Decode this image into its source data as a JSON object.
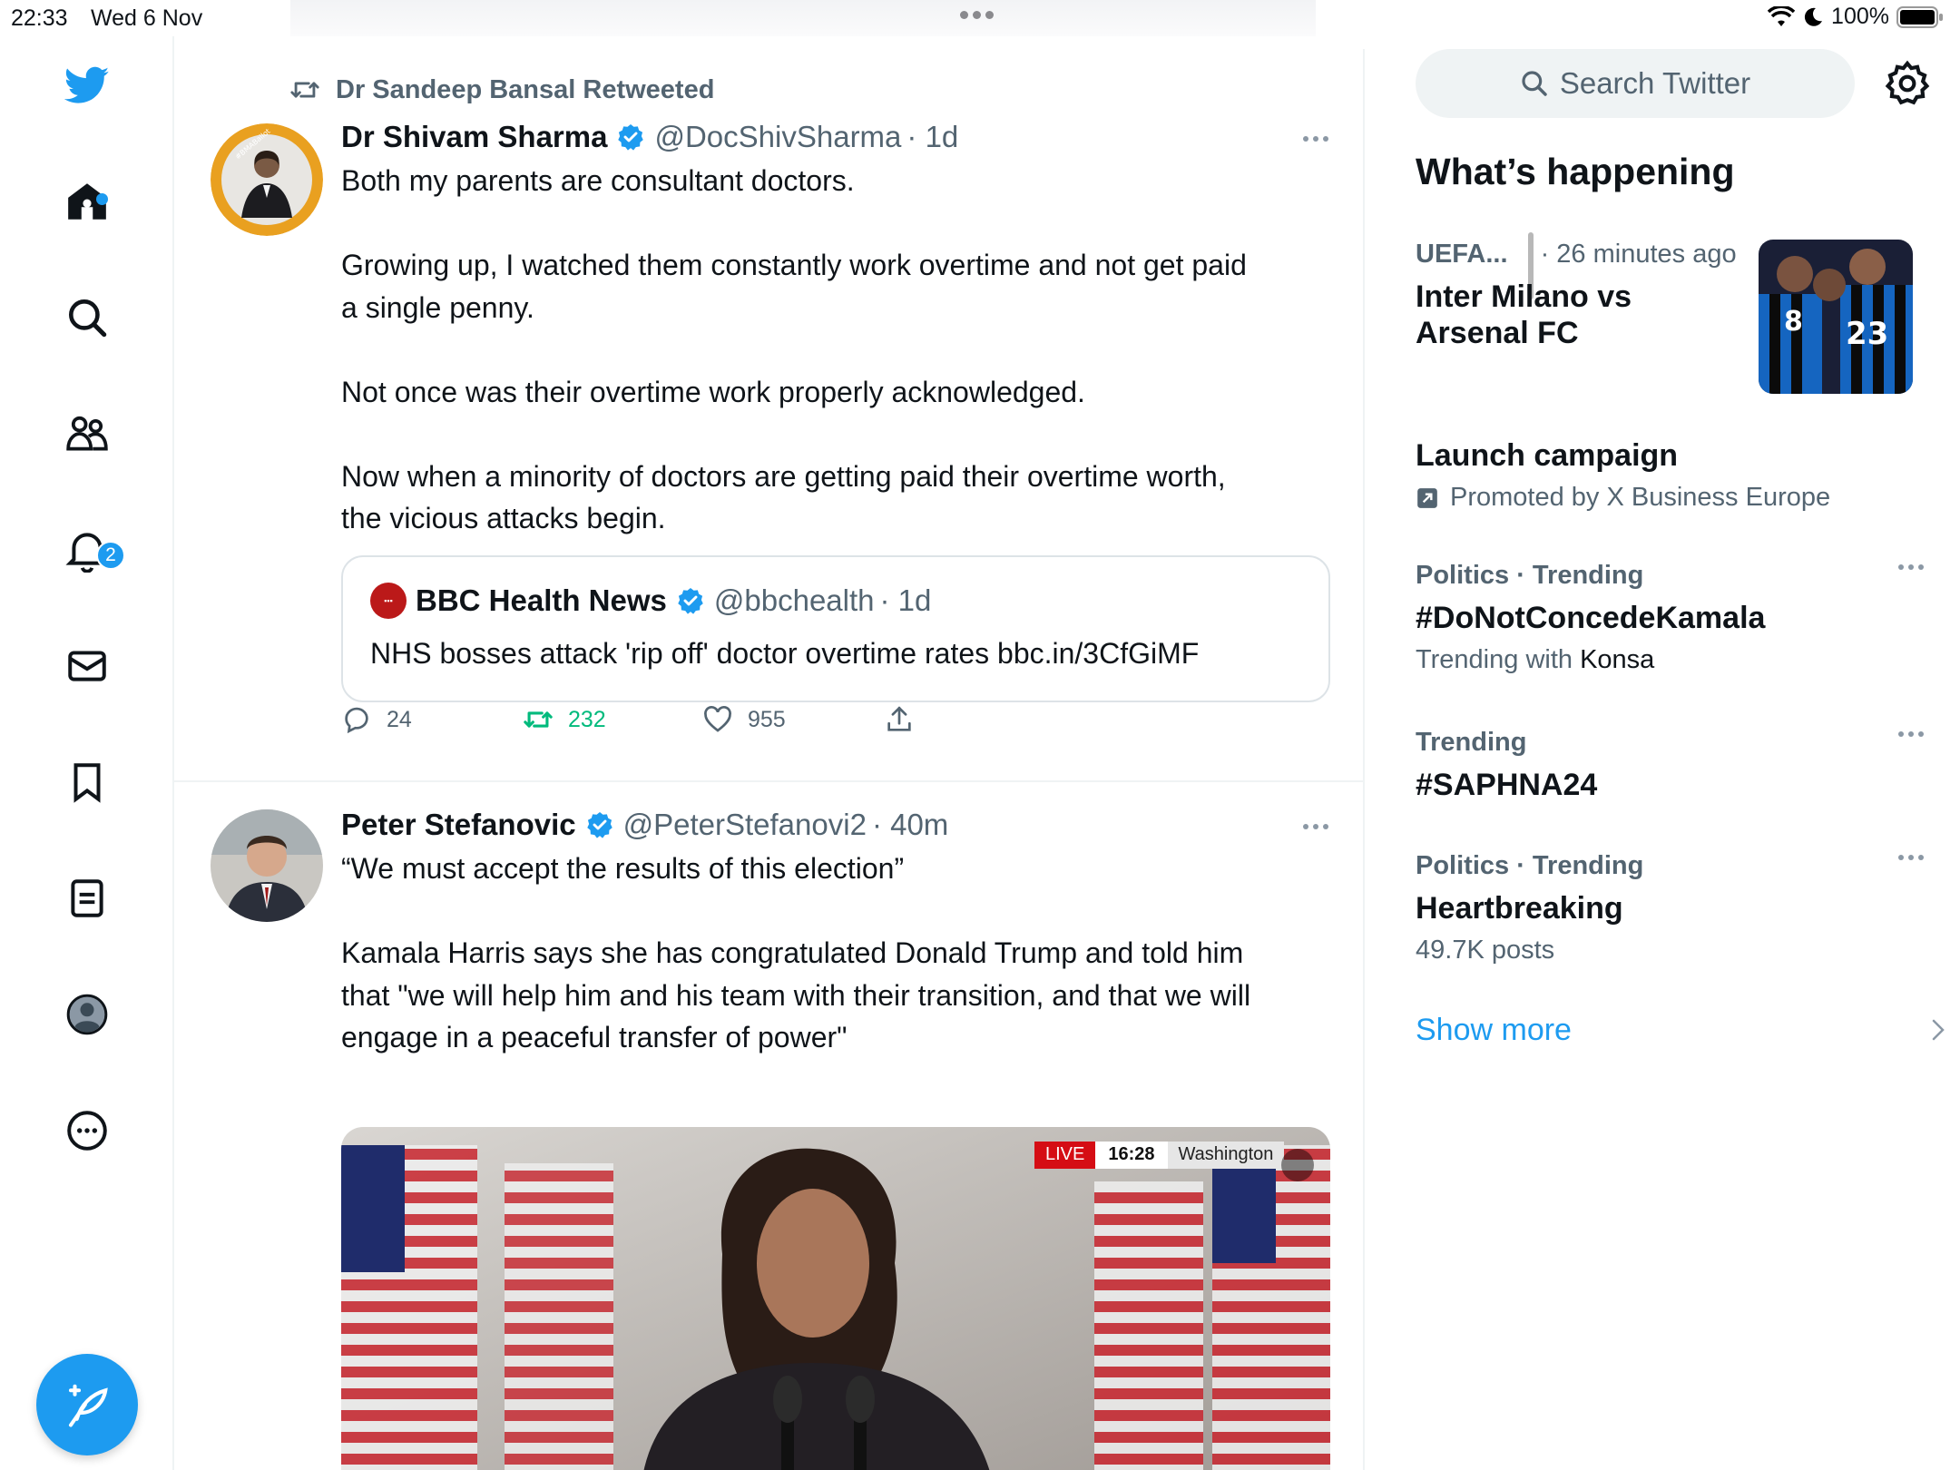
{
  "status_bar": {
    "time": "22:33",
    "date": "Wed 6 Nov",
    "battery": "100%"
  },
  "nav": {
    "notification_count": "2"
  },
  "tweets": [
    {
      "retweeted_by": "Dr Sandeep Bansal Retweeted",
      "name": "Dr Shivam Sharma",
      "handle": "@DocShivSharma",
      "time": "· 1d",
      "lines": [
        "Both my parents are consultant doctors.",
        "",
        "Growing up, I watched them constantly work overtime and not get paid",
        "a single penny.",
        "",
        "Not once was their overtime work properly acknowledged.",
        "",
        "Now when a minority of doctors are getting paid their overtime worth,",
        "the vicious attacks begin."
      ],
      "quote": {
        "name": "BBC Health News",
        "handle": "@bbchealth",
        "time": "· 1d",
        "text": "NHS bosses attack 'rip off' doctor overtime rates bbc.in/3CfGiMF"
      },
      "replies": "24",
      "retweets": "232",
      "likes": "955"
    },
    {
      "name": "Peter Stefanovic",
      "handle": "@PeterStefanovi2",
      "time": "· 40m",
      "lines": [
        "“We must accept the results of this election”",
        "",
        "Kamala Harris says she has congratulated Donald Trump and told him",
        "that \"we will help him and his team with their transition, and that we will",
        "engage in a peaceful transfer of power\""
      ],
      "media_overlay": {
        "live": "LIVE",
        "clock": "16:28",
        "place": "Washington"
      }
    }
  ],
  "sidebar": {
    "search_placeholder": "Search Twitter",
    "title": "What’s happening",
    "trends": [
      {
        "meta": "UEFA...",
        "meta_time": "· 26 minutes ago",
        "title": "Inter Milano vs Arsenal FC"
      },
      {
        "title": "Launch campaign",
        "sub": "Promoted by X Business Europe"
      },
      {
        "meta": "Politics · Trending",
        "title": "#DoNotConcedeKamala",
        "sub_prefix": "Trending with ",
        "sub_strong": "Konsa"
      },
      {
        "meta": "Trending",
        "title": "#SAPHNA24"
      },
      {
        "meta": "Politics · Trending",
        "title": "Heartbreaking",
        "sub": "49.7K posts"
      }
    ],
    "show_more": "Show more"
  },
  "colors": {
    "accent": "#1d9bf0",
    "retweet_green": "#00ba7c",
    "muted": "#536471"
  }
}
